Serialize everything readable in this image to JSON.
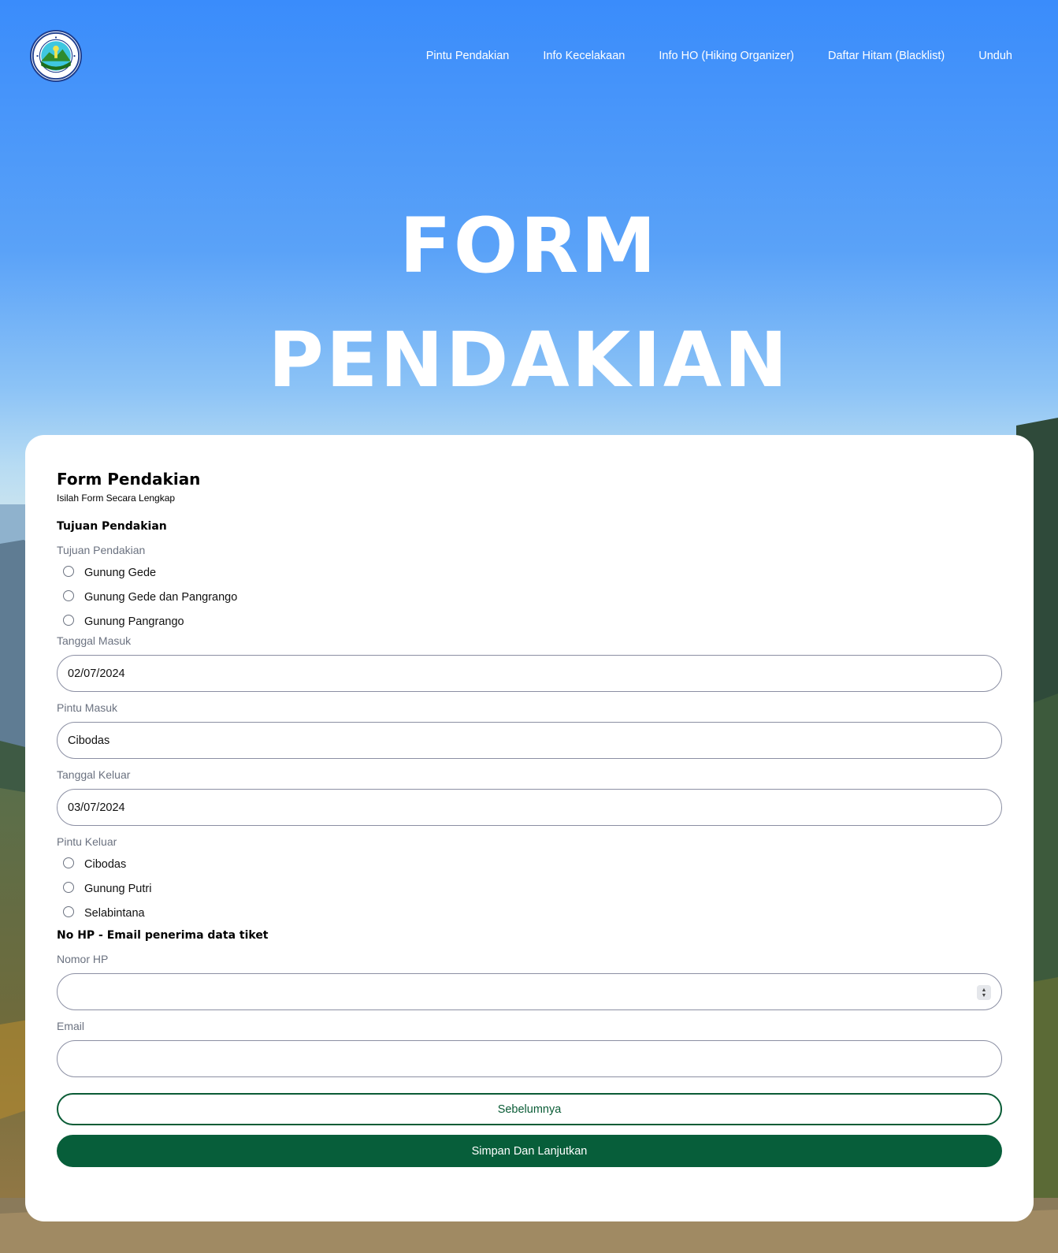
{
  "nav": {
    "logo_alt": "Taman Nasional Gunung Gede Pangrango",
    "links": [
      {
        "label": "Pintu Pendakian"
      },
      {
        "label": "Info Kecelakaan"
      },
      {
        "label": "Info HO (Hiking Organizer)"
      },
      {
        "label": "Daftar Hitam (Blacklist)"
      },
      {
        "label": "Unduh"
      }
    ]
  },
  "hero": {
    "line1": "FORM",
    "line2": "PENDAKIAN"
  },
  "form": {
    "title": "Form Pendakian",
    "subtitle": "Isilah Form Secara Lengkap",
    "section_tujuan": "Tujuan Pendakian",
    "tujuan_label": "Tujuan Pendakian",
    "tujuan_options": [
      "Gunung Gede",
      "Gunung Gede dan Pangrango",
      "Gunung Pangrango"
    ],
    "tanggal_masuk_label": "Tanggal Masuk",
    "tanggal_masuk_value": "02/07/2024",
    "pintu_masuk_label": "Pintu Masuk",
    "pintu_masuk_value": "Cibodas",
    "tanggal_keluar_label": "Tanggal Keluar",
    "tanggal_keluar_value": "03/07/2024",
    "pintu_keluar_label": "Pintu Keluar",
    "pintu_keluar_options": [
      "Cibodas",
      "Gunung Putri",
      "Selabintana"
    ],
    "section_kontak": "No HP - Email penerima data tiket",
    "nomor_hp_label": "Nomor HP",
    "nomor_hp_value": "",
    "email_label": "Email",
    "email_value": "",
    "btn_prev": "Sebelumnya",
    "btn_next": "Simpan Dan Lanjutkan"
  },
  "colors": {
    "primary_green": "#075e3a",
    "sky_blue": "#3d8ffa",
    "label_gray": "#6b7280"
  }
}
